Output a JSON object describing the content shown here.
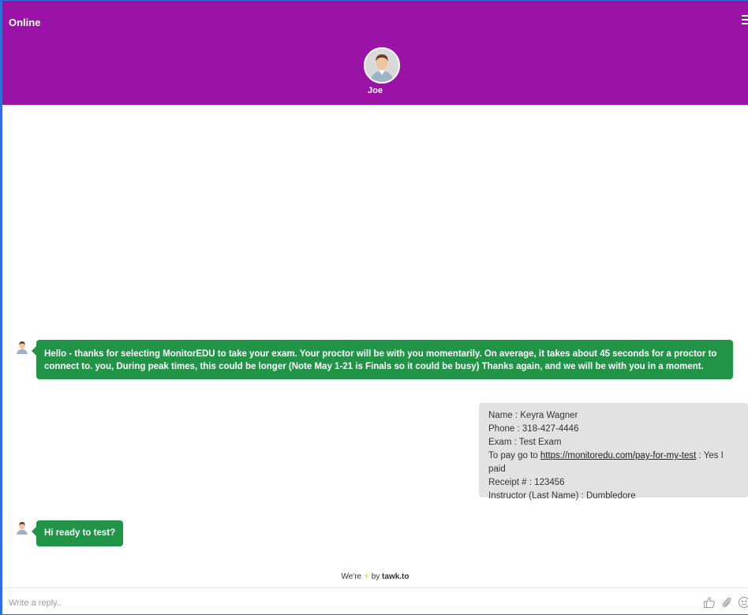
{
  "header": {
    "status": "Online",
    "agent_name": "Joe",
    "background_color": "#9b13a6"
  },
  "messages": {
    "agent_message_1": "Hello - thanks for selecting MonitorEDU to take your exam.   Your proctor will be with you momentarily.  On average, it takes about 45 seconds for a proctor to connect to. you,   During peak times, this could be longer (Note May 1-21 is Finals so it could be busy)  Thanks again, and we will be with you in a moment.",
    "visitor_message": {
      "name_line": "Name : Keyra Wagner",
      "phone_line": "Phone : 318-427-4446",
      "exam_line": "Exam : Test Exam",
      "pay_prefix": "To pay go to ",
      "pay_link": "https://monitoredu.com/pay-for-my-test",
      "pay_suffix": "  : Yes I paid",
      "receipt_line": "Receipt # : 123456",
      "instructor_line": "Instructor (Last Name) : Dumbledore"
    },
    "agent_message_2": "Hi ready to test?",
    "agent_bubble_color": "#229447"
  },
  "footer": {
    "powered_prefix": "We're",
    "powered_by": "by",
    "brand": "tawk.to",
    "reply_placeholder": "Write a reply..",
    "icons": [
      "thumbs-up-icon",
      "paperclip-icon",
      "emoji-icon"
    ]
  }
}
